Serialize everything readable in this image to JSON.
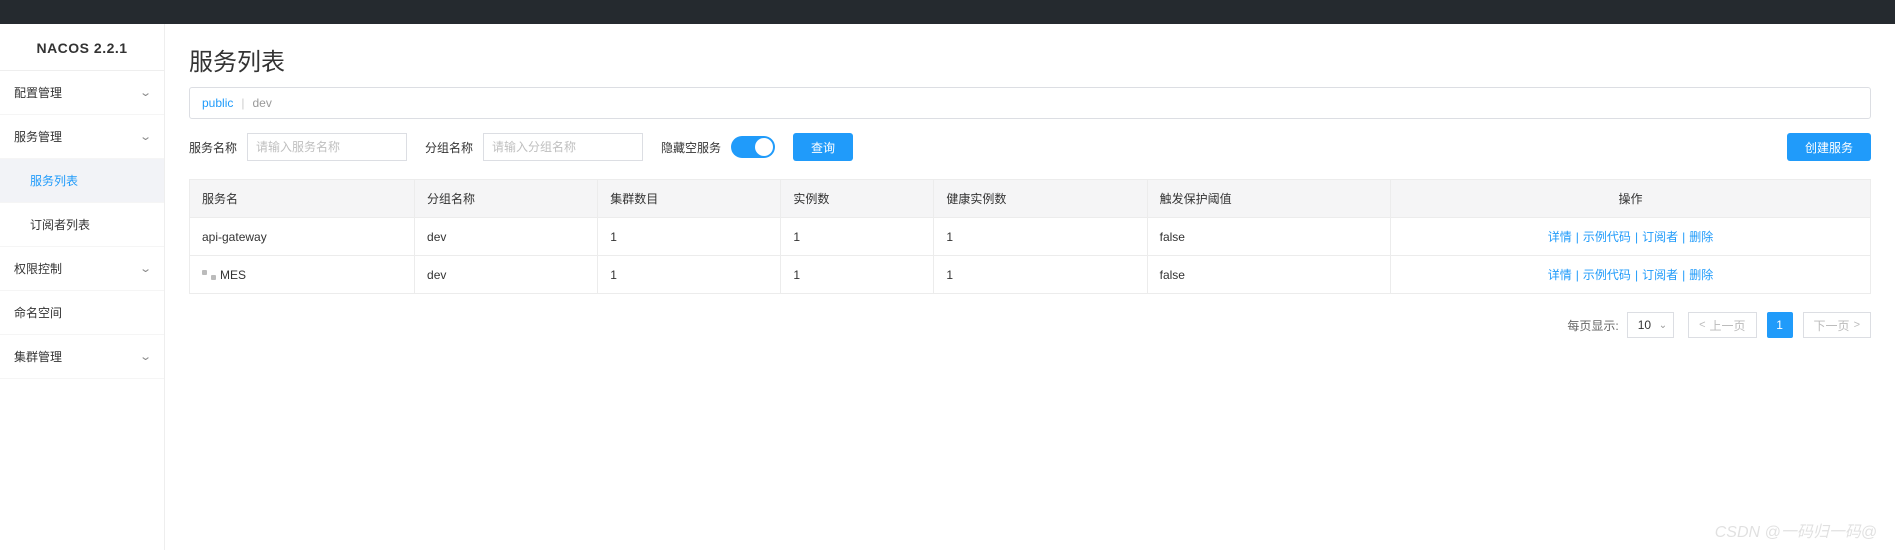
{
  "brand": "NACOS 2.2.1",
  "sidebar": {
    "items": [
      {
        "label": "配置管理",
        "expandable": true
      },
      {
        "label": "服务管理",
        "expandable": true,
        "children": [
          {
            "label": "服务列表",
            "active": true
          },
          {
            "label": "订阅者列表"
          }
        ]
      },
      {
        "label": "权限控制",
        "expandable": true
      },
      {
        "label": "命名空间",
        "expandable": false
      },
      {
        "label": "集群管理",
        "expandable": true
      }
    ]
  },
  "page": {
    "title": "服务列表"
  },
  "tabs": {
    "active": "public",
    "other": "dev"
  },
  "filter": {
    "service_label": "服务名称",
    "service_placeholder": "请输入服务名称",
    "group_label": "分组名称",
    "group_placeholder": "请输入分组名称",
    "hide_empty_label": "隐藏空服务",
    "query_btn": "查询",
    "create_btn": "创建服务"
  },
  "table": {
    "headers": [
      "服务名",
      "分组名称",
      "集群数目",
      "实例数",
      "健康实例数",
      "触发保护阈值",
      "操作"
    ],
    "ops": {
      "detail": "详情",
      "sample": "示例代码",
      "subscriber": "订阅者",
      "delete": "删除"
    },
    "rows": [
      {
        "name": "api-gateway",
        "group": "dev",
        "clusters": "1",
        "instances": "1",
        "healthy": "1",
        "threshold": "false",
        "icon": false
      },
      {
        "name": "MES",
        "group": "dev",
        "clusters": "1",
        "instances": "1",
        "healthy": "1",
        "threshold": "false",
        "icon": true
      }
    ]
  },
  "pagination": {
    "per_page_label": "每页显示:",
    "page_size": "10",
    "prev": "上一页",
    "next": "下一页",
    "current": "1"
  },
  "watermark": "CSDN @一码归一码@"
}
